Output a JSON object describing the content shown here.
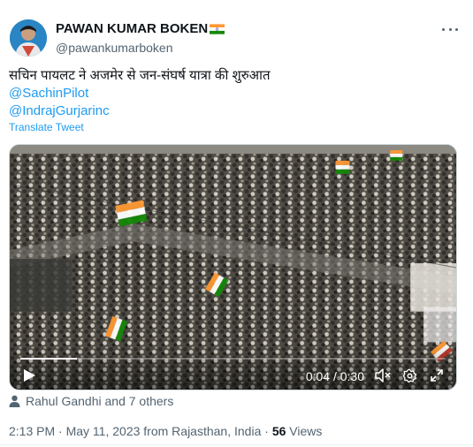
{
  "author": {
    "name": "PAWAN KUMAR BOKEN",
    "handle": "@pawankumarboken"
  },
  "tweet": {
    "text": "सचिन पायलट ने अजमेर से जन-संघर्ष यात्रा की शुरुआत",
    "mentions": [
      "@SachinPilot",
      "@IndrajGurjarinc"
    ],
    "translate_label": "Translate Tweet"
  },
  "video": {
    "current_time": "0:04",
    "separator": " / ",
    "duration": "0:30",
    "progress_fraction": 0.133
  },
  "tagged": {
    "label": "Rahul Gandhi and 7 others"
  },
  "meta": {
    "time": "2:13 PM",
    "sep1": " · ",
    "date": "May 11, 2023",
    "location": " from Rajasthan, India",
    "sep2": " · ",
    "views_count": "56",
    "views_label": " Views"
  },
  "colors": {
    "link": "#1d9bf0",
    "secondary_text": "#536471",
    "primary_text": "#0f1419"
  },
  "icons": {
    "more": "more-icon",
    "play": "play-icon",
    "mute": "mute-icon",
    "settings": "settings-icon",
    "fullscreen": "fullscreen-icon",
    "person": "person-icon",
    "flag": "india-flag-icon"
  }
}
